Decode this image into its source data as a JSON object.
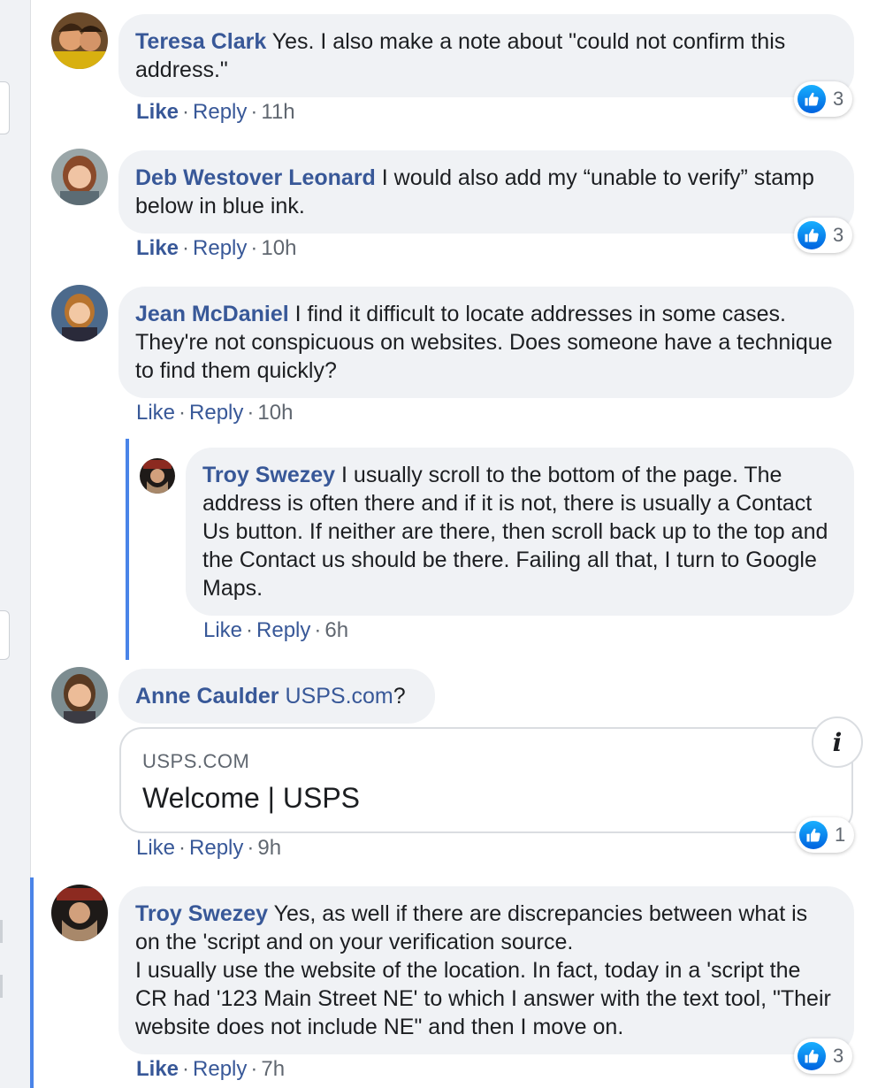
{
  "colors": {
    "author": "#385898",
    "bubble": "#f0f2f5",
    "like_blue": "#1877f2",
    "thread_line": "#4a84e8"
  },
  "comments": [
    {
      "author": "Teresa Clark",
      "text": " Yes. I also make a note about \"could not confirm this address.\"",
      "like": "Like",
      "reply": "Reply",
      "time": "11h",
      "reactions": {
        "icon": "thumbs-up-icon",
        "count": "3"
      }
    },
    {
      "author": "Deb Westover Leonard",
      "text": " I would also add my “unable to verify” stamp below in blue ink.",
      "like": "Like",
      "reply": "Reply",
      "time": "10h",
      "reactions": {
        "icon": "thumbs-up-icon",
        "count": "3"
      }
    },
    {
      "author": "Jean McDaniel",
      "text": " I find it difficult to locate addresses in some cases. They're not conspicuous on websites. Does someone have a technique to find them quickly?",
      "like": "Like",
      "reply": "Reply",
      "time": "10h",
      "replies": [
        {
          "author": "Troy Swezey",
          "text": " I usually scroll to the bottom of the page. The address is often there and if it is not, there is usually a Contact Us button. If neither are there, then scroll back up to the top and the Contact us should be there. Failing all that, I turn to Google Maps.",
          "like": "Like",
          "reply": "Reply",
          "time": "6h"
        }
      ]
    },
    {
      "author": "Anne Caulder",
      "link_text": "USPS.com",
      "text": "?",
      "link_preview": {
        "domain": "USPS.COM",
        "title": "Welcome | USPS",
        "info": "i"
      },
      "like": "Like",
      "reply": "Reply",
      "time": "9h",
      "reactions": {
        "icon": "thumbs-up-icon",
        "count": "1"
      }
    },
    {
      "author": "Troy Swezey",
      "text": " Yes, as well if there are discrepancies between what is on the 'script and on your verification source.",
      "text2": "I usually use the website of the location. In fact, today in a 'script the CR had '123 Main Street NE' to which I answer with the text tool, \"Their website does not include NE\" and then I move on.",
      "like": "Like",
      "reply": "Reply",
      "time": "7h",
      "reactions": {
        "icon": "thumbs-up-icon",
        "count": "3"
      }
    }
  ],
  "separator": "·"
}
